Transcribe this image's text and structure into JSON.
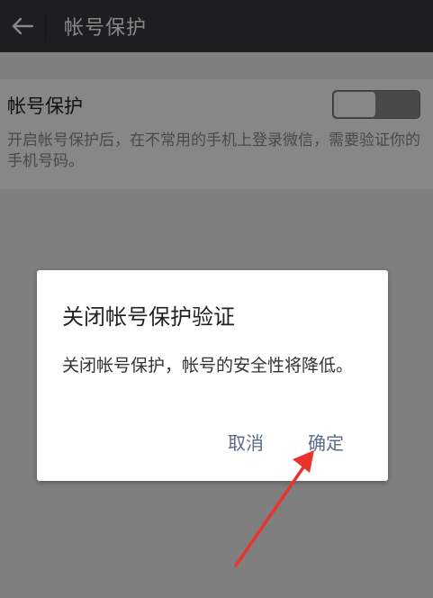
{
  "topbar": {
    "back_icon": "back-arrow-icon",
    "title": "帐号保护"
  },
  "setting": {
    "title": "帐号保护",
    "description": "开启帐号保护后，在不常用的手机上登录微信，需要验证你的手机号码。",
    "toggle_state": "off"
  },
  "dialog": {
    "title": "关闭帐号保护验证",
    "message": "关闭帐号保护，帐号的安全性将降低。",
    "cancel_label": "取消",
    "confirm_label": "确定"
  },
  "colors": {
    "topbar": "#393a3f",
    "dialog_button_text": "#5b6a85",
    "annotation_arrow": "#e8342d"
  }
}
